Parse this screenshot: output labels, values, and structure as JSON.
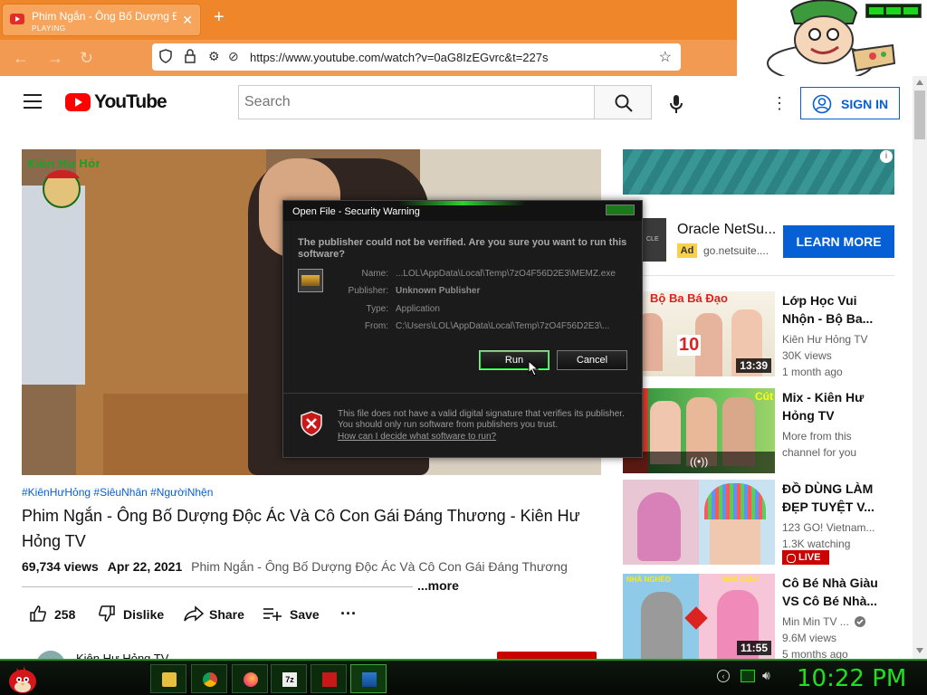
{
  "browser": {
    "tab_title": "Phim Ngắn - Ông Bố Dượng Đ",
    "tab_status": "PLAYING",
    "url": "https://www.youtube.com/watch?v=0aG8IzEGvrc&t=227s"
  },
  "youtube": {
    "logo_text": "YouTube",
    "search_placeholder": "Search",
    "sign_in": "SIGN IN"
  },
  "video": {
    "channel_watermark": "Kiên Hư Hỏng",
    "hashtags": "#KiênHưHỏng #SiêuNhân #NgườiNhện",
    "title": "Phim Ngắn - Ông Bố Dượng Độc Ác Và Cô Con Gái Đáng Thương - Kiên Hư Hỏng TV",
    "views": "69,734 views",
    "date": "Apr 22, 2021",
    "description": "Phim Ngắn - Ông Bố Dượng Độc Ác Và Cô Con Gái Đáng Thương",
    "more": "...more",
    "likes": "258",
    "dislike": "Dislike",
    "share": "Share",
    "save": "Save",
    "channel_name": "Kiên Hư Hỏng TV"
  },
  "ad": {
    "title": "Oracle NetSu...",
    "badge": "Ad",
    "domain": "go.netsuite....",
    "cta": "LEARN MORE",
    "thumb_text": "CLE"
  },
  "recommendations": [
    {
      "title": "Lớp Học Vui Nhộn - Bộ Ba...",
      "thumb_caption": "Bộ Ba Bá Đạo",
      "thumb_number": "10",
      "duration": "13:39",
      "meta1": "Kiên Hư Hỏng TV",
      "meta2": "30K views",
      "meta3": "1 month ago"
    },
    {
      "title": "Mix - Kiên Hư Hỏng TV",
      "thumb_caption": "Cút",
      "meta1": "More from this",
      "meta2": "channel for you"
    },
    {
      "title": "ĐỒ DÙNG LÀM ĐẸP TUYỆT V...",
      "meta1": "123 GO! Vietnam...",
      "meta2": "1.3K watching",
      "live": "LIVE"
    },
    {
      "title": "Cô Bé Nhà Giàu VS Cô Bé Nhà...",
      "thumb_caption_left": "NHÀ NGHÈO",
      "thumb_caption_right": "NHÀ GIÀU",
      "duration": "11:55",
      "meta1": "Min Min TV ...",
      "meta2": "9.6M views",
      "meta3": "5 months ago"
    }
  ],
  "dialog": {
    "title": "Open File - Security Warning",
    "question": "The publisher could not be verified.  Are you sure you want to run this software?",
    "name_label": "Name:",
    "name_value": "...LOL\\AppData\\Local\\Temp\\7zO4F56D2E3\\MEMZ.exe",
    "publisher_label": "Publisher:",
    "publisher_value": "Unknown Publisher",
    "type_label": "Type:",
    "type_value": "Application",
    "from_label": "From:",
    "from_value": "C:\\Users\\LOL\\AppData\\Local\\Temp\\7zO4F56D2E3\\...",
    "run": "Run",
    "cancel": "Cancel",
    "warning": "This file does not have a valid digital signature that verifies its publisher.  You should only run software from publishers you trust.",
    "help_link": "How can I decide what software to run?"
  },
  "taskbar": {
    "clock": "10:22 PM"
  },
  "colors": {
    "youtube_red": "#ff0000",
    "link_blue": "#065fd4",
    "taskbar_green": "#21e021",
    "browser_orange": "#f0862a"
  }
}
